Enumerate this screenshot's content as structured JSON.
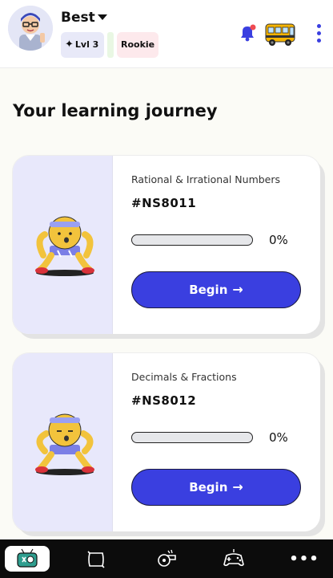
{
  "header": {
    "username": "Best",
    "level": "Lvl 3",
    "rank": "Rookie"
  },
  "section": {
    "title": "Your learning journey"
  },
  "cards": [
    {
      "topic": "Rational & Irrational Numbers",
      "code": "#NS8011",
      "progress_percent": 0,
      "progress_text": "0%",
      "button_label": "Begin"
    },
    {
      "topic": "Decimals & Fractions",
      "code": "#NS8012",
      "progress_percent": 0,
      "progress_text": "0%",
      "button_label": "Begin"
    }
  ],
  "bottom_nav": {
    "items": [
      "home-icon",
      "map-icon",
      "whistle-icon",
      "gamepad-icon",
      "more-icon"
    ],
    "more_label": "•••"
  },
  "colors": {
    "accent": "#3a3fe0",
    "card_art_bg": "#e8e8fb",
    "nav_bg": "#0c0c0c"
  }
}
